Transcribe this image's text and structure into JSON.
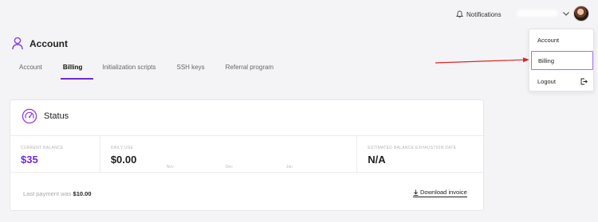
{
  "header": {
    "notifications_label": "Notifications"
  },
  "page": {
    "title": "Account"
  },
  "tabs": [
    {
      "label": "Account",
      "active": false
    },
    {
      "label": "Billing",
      "active": true
    },
    {
      "label": "Initialization scripts",
      "active": false
    },
    {
      "label": "SSH keys",
      "active": false
    },
    {
      "label": "Referral program",
      "active": false
    }
  ],
  "status_card": {
    "title": "Status",
    "current_balance": {
      "label": "Current balance",
      "value": "$35"
    },
    "daily_use": {
      "label": "Daily use",
      "value": "$0.00",
      "months": [
        "Nov",
        "Dec",
        "Jan"
      ]
    },
    "estimated_exhaustion": {
      "label": "Estimated balance exhaustion date",
      "value": "N/A"
    },
    "last_payment_prefix": "Last payment was",
    "last_payment_amount": "$10.00",
    "download_label": "Download invoice"
  },
  "dropdown": {
    "items": [
      {
        "label": "Account"
      },
      {
        "label": "Billing",
        "highlighted": true
      },
      {
        "label": "Logout"
      }
    ]
  },
  "colors": {
    "accent": "#6f2bd9",
    "annotation_arrow": "#e02424",
    "background": "#f4f4f6"
  }
}
